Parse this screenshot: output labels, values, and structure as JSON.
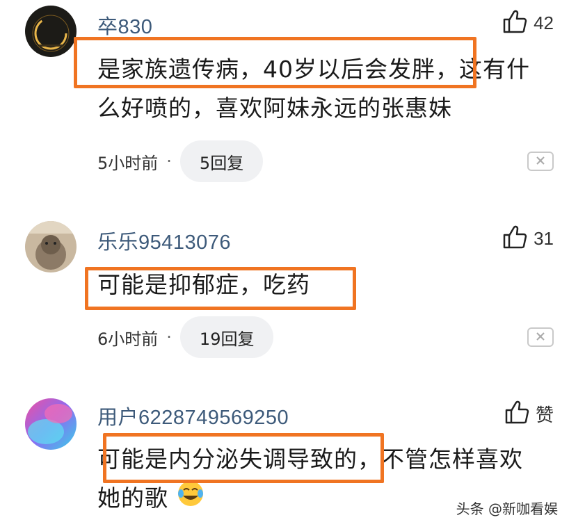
{
  "comments": [
    {
      "username": "卒830",
      "likes": "42",
      "text_highlighted": "是家族遗传病，40岁以后会发胖，",
      "text_rest_line1": "这有什",
      "text_line2": "么好喷的，喜欢阿妹永远的张惠妹",
      "time": "5小时前",
      "separator": "·",
      "replies": "5回复"
    },
    {
      "username": "乐乐95413076",
      "likes": "31",
      "text_highlighted": "可能是抑郁症，吃药",
      "time": "6小时前",
      "separator": "·",
      "replies": "19回复"
    },
    {
      "username": "用户6228749569250",
      "likes": "赞",
      "text_highlighted": "可能是内分泌失调导致的",
      "text_rest_line1": "，不管怎样喜欢",
      "text_line2": "她的歌"
    }
  ],
  "watermark": "头条 @新咖看娱",
  "colors": {
    "highlight": "#f07422",
    "username": "#3d5a7a",
    "reply_bg": "#f0f1f3"
  },
  "icons": [
    "thumbs-up-icon",
    "close-icon",
    "crying-laughing-emoji"
  ]
}
